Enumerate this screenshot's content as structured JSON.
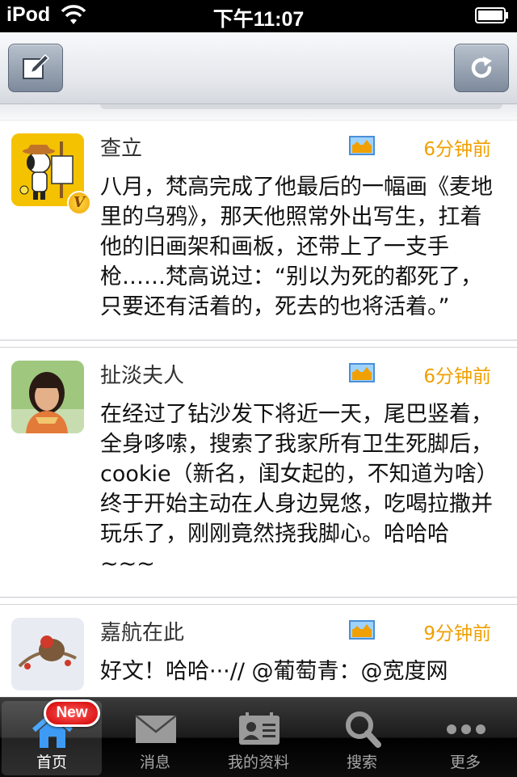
{
  "statusbar": {
    "carrier": "iPod",
    "time": "下午11:07"
  },
  "navbar": {
    "left_icon": "compose-icon",
    "right_icon": "refresh-icon"
  },
  "posts": [
    {
      "name": "查立",
      "time": "6分钟前",
      "verified": true,
      "text": "八月，梵高完成了他最后的一幅画《麦地里的乌鸦》，那天他照常外出写生，扛着他的旧画架和画板，还带上了一支手枪……梵高说过：“别以为死的都死了，只要还有活着的，死去的也将活着。”"
    },
    {
      "name": "扯淡夫人",
      "time": "6分钟前",
      "verified": false,
      "text": "在经过了钻沙发下将近一天，尾巴竖着，全身哆嗦，搜索了我家所有卫生死脚后，cookie（新名，闺女起的，不知道为啥）终于开始主动在人身边晃悠，吃喝拉撒并玩乐了，刚刚竟然挠我脚心。哈哈哈~~~"
    },
    {
      "name": "嘉航在此",
      "time": "9分钟前",
      "verified": false,
      "text": "好文！哈哈···// @葡萄青：@宽度网"
    }
  ],
  "badge": {
    "v": "V"
  },
  "tabbar": {
    "tabs": [
      {
        "label": "首页",
        "icon": "home-icon",
        "badge": "New"
      },
      {
        "label": "消息",
        "icon": "envelope-icon"
      },
      {
        "label": "我的资料",
        "icon": "profile-card-icon"
      },
      {
        "label": "搜索",
        "icon": "search-icon"
      },
      {
        "label": "更多",
        "icon": "more-icon"
      }
    ]
  },
  "colors": {
    "time": "#f0a000",
    "tab_active": "#ffffff",
    "tab_inactive": "#a6a6a6"
  }
}
